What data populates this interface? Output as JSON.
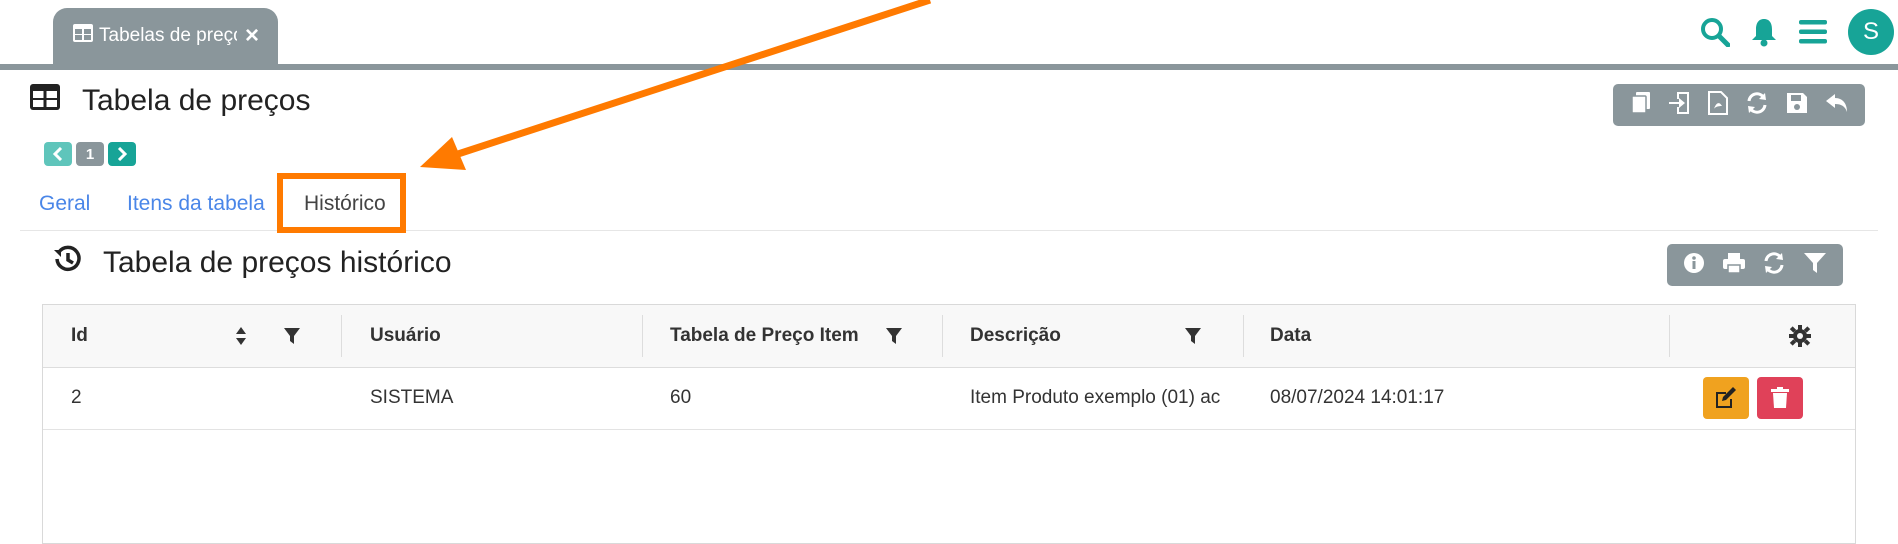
{
  "tabbar": {
    "doc_tab_label": "Tabelas de preços",
    "doc_tab_close": "×",
    "avatar_letter": "S"
  },
  "page": {
    "title": "Tabela de preços"
  },
  "pager": {
    "current_page": "1"
  },
  "tabs": [
    {
      "label": "Geral"
    },
    {
      "label": "Itens da tabela"
    },
    {
      "label": "Histórico"
    }
  ],
  "section": {
    "title": "Tabela de preços histórico"
  },
  "grid": {
    "columns": [
      "Id",
      "Usuário",
      "Tabela de Preço Item",
      "Descrição",
      "Data"
    ],
    "rows": [
      {
        "id": "2",
        "usuario": "SISTEMA",
        "tabela_item": "60",
        "descricao": "Item Produto exemplo (01) ac",
        "data": "08/07/2024 14:01:17"
      }
    ]
  },
  "colors": {
    "accent_teal": "#17a497",
    "toolbar_gray": "#8a969b",
    "link_blue": "#4a86e8",
    "edit_orange": "#f0a21f",
    "delete_red": "#e04159",
    "annotation_orange": "#ff7a00"
  },
  "icons": {
    "top": [
      "search-icon",
      "bell-icon",
      "menu-icon"
    ],
    "toolbar": [
      "copy-icon",
      "import-icon",
      "pdf-icon",
      "refresh-icon",
      "save-icon",
      "undo-icon"
    ],
    "section_toolbar": [
      "info-icon",
      "print-icon",
      "refresh-icon",
      "filter-icon"
    ]
  }
}
